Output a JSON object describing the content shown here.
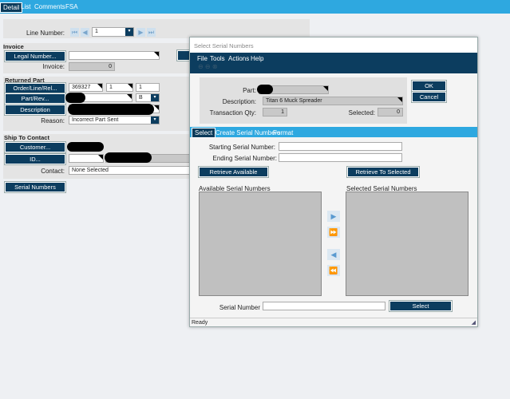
{
  "tabs": [
    "Detail",
    "List",
    "Comments",
    "FSA"
  ],
  "line_number": {
    "label": "Line Number:",
    "value": "1"
  },
  "invoice": {
    "header": "Invoice",
    "legal_number_btn": "Legal Number...",
    "invoice_label": "Invoice:",
    "invoice_value": "0"
  },
  "returned_part": {
    "header": "Returned Part",
    "order_btn": "Order/Line/Rel...",
    "order": "369327",
    "line": "1",
    "rel": "1",
    "part_btn": "Part/Rev...",
    "rev": "B",
    "description_btn": "Description",
    "reason_label": "Reason:",
    "reason": "Incorrect Part Sent"
  },
  "ship_to": {
    "header": "Ship To Contact",
    "customer_btn": "Customer...",
    "id_btn": "ID...",
    "contact_label": "Contact:",
    "contact": "None Selected"
  },
  "serial_numbers_btn": "Serial Numbers",
  "modal": {
    "title": "Select Serial Numbers",
    "menu": [
      "File",
      "Tools",
      "Actions",
      "Help"
    ],
    "part_label": "Part:",
    "description_label": "Description:",
    "description": "Titan 6 Muck Spreader",
    "qty_label": "Transaction Qty:",
    "qty": "1",
    "selected_label": "Selected:",
    "selected": "0",
    "ok": "OK",
    "cancel": "Cancel",
    "tabs": [
      "Select",
      "Create Serial Numbers",
      "Format"
    ],
    "start_label": "Starting Serial Number:",
    "end_label": "Ending Serial Number:",
    "retrieve_available": "Retrieve Available",
    "retrieve_selected": "Retrieve To Selected",
    "available_label": "Available Serial Numbers",
    "selected_list_label": "Selected Serial Numbers",
    "serial_label": "Serial Number",
    "select_btn": "Select",
    "status": "Ready"
  }
}
